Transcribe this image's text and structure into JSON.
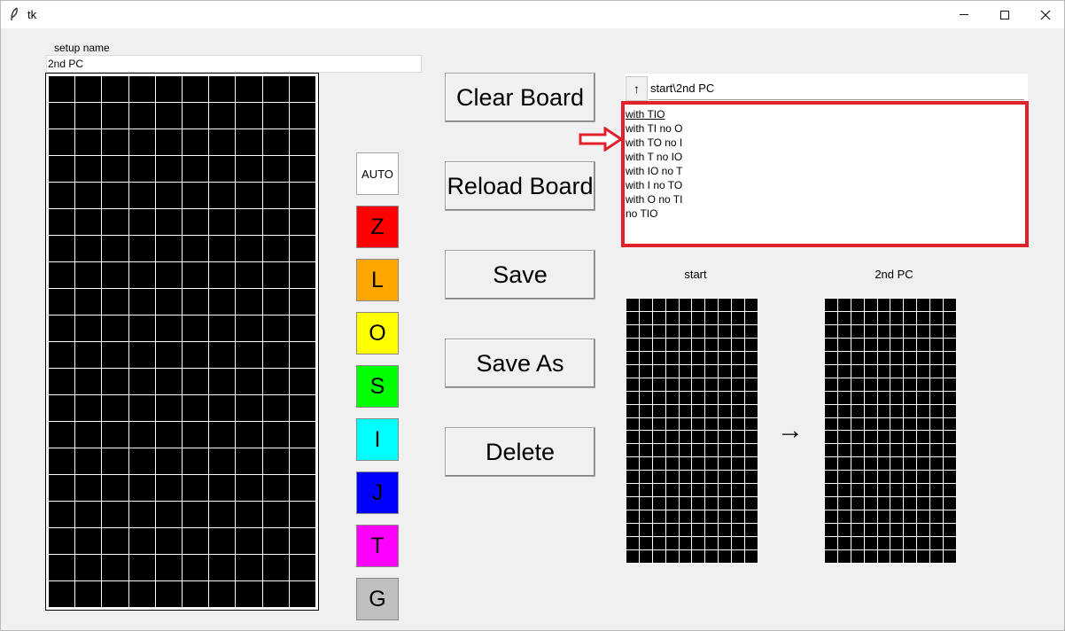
{
  "window": {
    "title": "tk",
    "minimize": "–",
    "maximize": "☐",
    "close": "✕"
  },
  "setup": {
    "label": "setup name",
    "value": "2nd PC"
  },
  "pieces": [
    {
      "label": "AUTO",
      "color": "#ffffff"
    },
    {
      "label": "Z",
      "color": "#ff0000"
    },
    {
      "label": "L",
      "color": "#ffa500"
    },
    {
      "label": "O",
      "color": "#ffff00"
    },
    {
      "label": "S",
      "color": "#00ff00"
    },
    {
      "label": "I",
      "color": "#00ffff"
    },
    {
      "label": "J",
      "color": "#0000ff"
    },
    {
      "label": "T",
      "color": "#ff00ff"
    },
    {
      "label": "G",
      "color": "#c0c0c0"
    }
  ],
  "actions": {
    "clear": "Clear Board",
    "reload": "Reload Board",
    "save": "Save",
    "save_as": "Save As",
    "delete": "Delete"
  },
  "navigator": {
    "up_label": "↑",
    "path": "start\\2nd PC",
    "items": [
      "with TIO",
      "with TI no O",
      "with TO no I",
      "with T no IO",
      "with IO no T",
      "with I no TO",
      "with O no TI",
      "no TIO"
    ]
  },
  "preview": {
    "left_label": "start",
    "right_label": "2nd PC",
    "arrow": "→"
  },
  "colors": {
    "highlight": "#e0202a",
    "board_bg": "#000000",
    "grid": "#ffffff"
  }
}
